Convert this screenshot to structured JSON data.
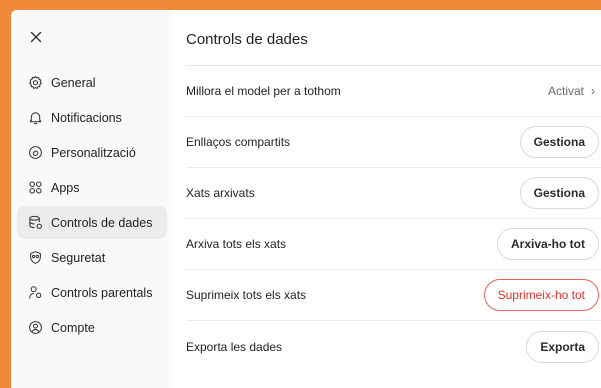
{
  "colors": {
    "background": "#ef8a3a",
    "sidebar": "#f9f9f9",
    "active_item": "#ececec",
    "danger": "#d6342c"
  },
  "window": {
    "close_icon": "close-icon"
  },
  "sidebar": {
    "items": [
      {
        "label": "General",
        "icon": "gear-icon"
      },
      {
        "label": "Notificacions",
        "icon": "bell-icon"
      },
      {
        "label": "Personalització",
        "icon": "personalize-icon"
      },
      {
        "label": "Apps",
        "icon": "apps-grid-icon"
      },
      {
        "label": "Controls de dades",
        "icon": "database-icon",
        "active": true
      },
      {
        "label": "Seguretat",
        "icon": "shield-icon"
      },
      {
        "label": "Controls parentals",
        "icon": "parental-icon"
      },
      {
        "label": "Compte",
        "icon": "account-icon"
      }
    ]
  },
  "main": {
    "title": "Controls de dades",
    "rows": [
      {
        "label": "Millora el model per a tothom",
        "value": "Activat",
        "chevron": "›"
      },
      {
        "label": "Enllaços compartits",
        "button": "Gestiona"
      },
      {
        "label": "Xats arxivats",
        "button": "Gestiona"
      },
      {
        "label": "Arxiva tots els xats",
        "button": "Arxiva-ho tot"
      },
      {
        "label": "Suprimeix tots els xats",
        "button": "Suprimeix-ho tot",
        "danger": true
      },
      {
        "label": "Exporta les dades",
        "button": "Exporta"
      }
    ]
  }
}
